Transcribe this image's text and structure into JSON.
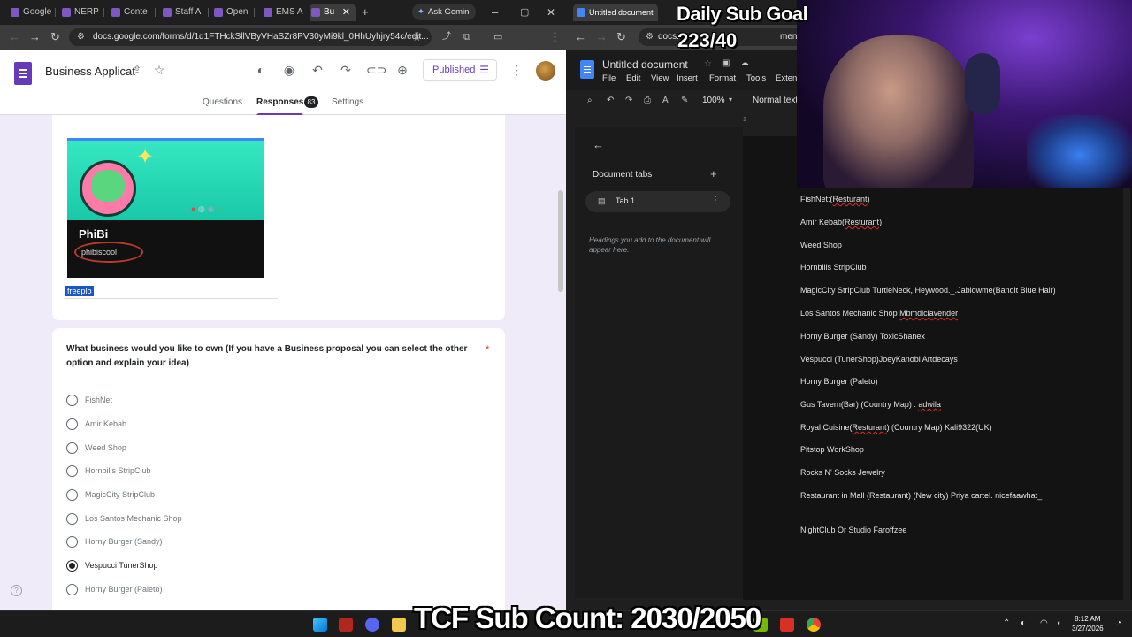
{
  "left_browser": {
    "tabs": [
      {
        "label": "Google"
      },
      {
        "label": "NERP"
      },
      {
        "label": "Conte"
      },
      {
        "label": "Staff A"
      },
      {
        "label": "Open"
      },
      {
        "label": "EMS A"
      },
      {
        "label": "Bu",
        "active": true
      }
    ],
    "ask_gemini": "Ask Gemini",
    "url": "docs.google.com/forms/d/1q1FTHckSllVByVHaSZr8PV30yMi9kl_0HhUyhjry54c/edit..."
  },
  "forms": {
    "title": "Business Applicat",
    "published_label": "Published",
    "tabs": {
      "questions": "Questions",
      "responses": "Responses",
      "responses_count": "83",
      "settings": "Settings"
    },
    "image_card": {
      "profile_name": "PhiBi",
      "profile_tag": "phibiscool",
      "answer_text": "freeplo"
    },
    "question": {
      "title": "What business would you like to own (If you have a Business proposal you can select the other option and explain your idea)",
      "required_mark": "*",
      "options": [
        {
          "label": "FishNet",
          "selected": false
        },
        {
          "label": "Amir Kebab",
          "selected": false
        },
        {
          "label": "Weed Shop",
          "selected": false
        },
        {
          "label": "Hornbills StripClub",
          "selected": false
        },
        {
          "label": "MagicCity StripClub",
          "selected": false
        },
        {
          "label": "Los Santos Mechanic Shop",
          "selected": false
        },
        {
          "label": "Horny Burger (Sandy)",
          "selected": false
        },
        {
          "label": "Vespucci TunerShop",
          "selected": true
        },
        {
          "label": "Horny Burger (Paleto)",
          "selected": false
        }
      ]
    },
    "help_icon": "?"
  },
  "right_browser": {
    "tab_label": "Untitled document",
    "url": "docs.",
    "url_tail": "ment/d/15mfM"
  },
  "docs": {
    "title": "Untitled document",
    "menu": [
      "File",
      "Edit",
      "View",
      "Insert",
      "Format",
      "Tools",
      "Exten"
    ],
    "zoom": "100%",
    "style": "Normal text",
    "panel": {
      "title": "Document tabs",
      "tab1": "Tab 1",
      "hint": "Headings you add to the document will appear here."
    },
    "lines": [
      {
        "pre": "FishNet:(",
        "spell": "Resturant",
        "post": ")"
      },
      {
        "pre": "Amir Kebab(",
        "spell": "Resturant",
        "post": ")"
      },
      {
        "pre": "Weed Shop",
        "spell": "",
        "post": ""
      },
      {
        "pre": "Hornbills StripClub",
        "spell": "",
        "post": ""
      },
      {
        "pre": "MagicCity StripClub TurtleNeck, Heywood._.Jablowme(Bandit Blue Hair)",
        "spell": "",
        "post": ""
      },
      {
        "pre": "Los Santos Mechanic Shop ",
        "spell": "Mbmdiclavender",
        "post": ""
      },
      {
        "pre": "Horny Burger (Sandy) ToxicShanex",
        "spell": "",
        "post": ""
      },
      {
        "pre": "Vespucci (TunerShop)JoeyKanobi Artdecays",
        "spell": "",
        "post": ""
      },
      {
        "pre": "Horny Burger (Paleto)",
        "spell": "",
        "post": ""
      },
      {
        "pre": "Gus Tavern(Bar) (Country Map) : ",
        "spell": "adwila",
        "post": ""
      },
      {
        "pre": "Royal Cuisine(",
        "spell": "Resturant",
        "post": ") (Country Map) Kali9322(UK)"
      },
      {
        "pre": "Pitstop WorkShop",
        "spell": "",
        "post": ""
      },
      {
        "pre": "Rocks N' Socks Jewelry",
        "spell": "",
        "post": ""
      },
      {
        "pre": "Restaurant in Mall (Restaurant) (New city) Priya cartel. nicefaawhat_",
        "spell": "",
        "post": ""
      },
      {
        "pre": "NightClub Or Studio Faroffzee",
        "spell": "",
        "post": ""
      }
    ]
  },
  "overlay": {
    "daily_goal_title": "Daily Sub Goal",
    "daily_goal_value": "223/40",
    "sub_count": "TCF Sub Count: 2030/2050"
  },
  "taskbar": {
    "time": "8:12 AM",
    "date": "3/27/2026"
  },
  "colors": {
    "forms_purple": "#673ab7",
    "form_bg": "#f0ebf8",
    "spellcheck": "#d93025",
    "docs_blue": "#4285f4"
  }
}
